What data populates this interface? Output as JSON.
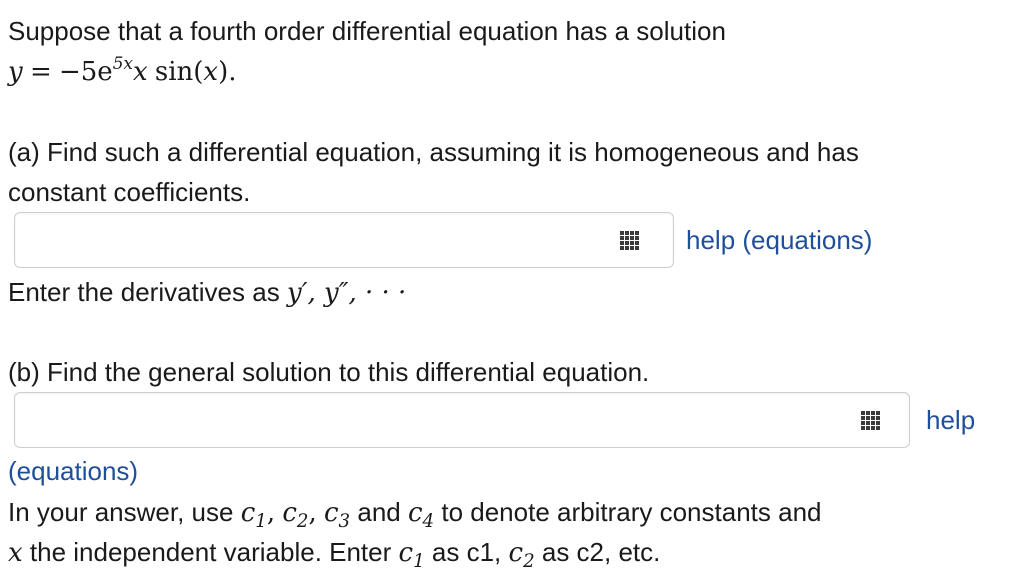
{
  "intro": {
    "text": "Suppose that a fourth order differential equation has a solution",
    "eq_lhs": "y",
    "eq_equals": "=",
    "eq_neg": "−5e",
    "eq_exp": "5x",
    "eq_x": "x",
    "eq_sin": "sin(",
    "eq_sin_arg": "x",
    "eq_close": ")."
  },
  "part_a": {
    "prompt_line1": "(a) Find such a differential equation, assuming it is homogeneous and has",
    "prompt_line2": "constant coefficients.",
    "input_value": "",
    "help_link": "help (equations)",
    "hint_text": "Enter the derivatives as",
    "hint_math": "y′,  y″,  · · ·"
  },
  "part_b": {
    "prompt": "(b) Find the general solution to this differential equation.",
    "input_value": "",
    "help_link_1": "help",
    "help_link_2": "(equations)",
    "instr_line1_a": "In your answer, use",
    "c1": "c",
    "c1_sub": "1",
    "c2": "c",
    "c2_sub": "2",
    "c3": "c",
    "c3_sub": "3",
    "and_word": "and",
    "c4": "c",
    "c4_sub": "4",
    "instr_line1_b": "to denote arbitrary constants and",
    "x_var": "x",
    "instr_line2_a": "the independent variable. Enter",
    "c1b": "c",
    "c1b_sub": "1",
    "as_c1": "as c1,",
    "c2b": "c",
    "c2b_sub": "2",
    "as_c2": "as c2, etc."
  }
}
